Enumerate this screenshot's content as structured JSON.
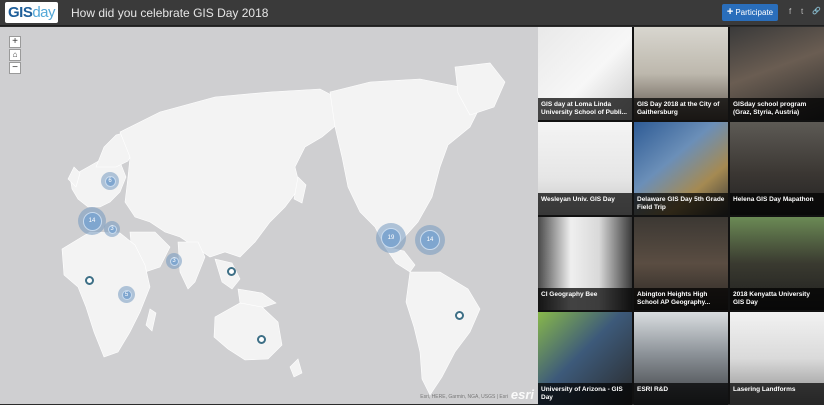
{
  "header": {
    "logo": {
      "gis": "GIS",
      "day": "day"
    },
    "title": "How did you celebrate GIS Day 2018",
    "participate_label": "Participate",
    "share_icons": [
      "facebook-icon",
      "twitter-icon",
      "link-icon"
    ],
    "share_glyphs": [
      "f",
      "t",
      "🔗"
    ]
  },
  "map": {
    "zoom_in": "+",
    "home_icon": "home-icon",
    "zoom_out": "−",
    "clusters": [
      {
        "count": "6"
      },
      {
        "count": "14"
      },
      {
        "count": "3"
      },
      {
        "count": "3"
      },
      {
        "count": "5"
      },
      {
        "count": "19"
      },
      {
        "count": "14"
      }
    ],
    "attribution": "Esri, HERE, Garmin, NGA, USGS | Esri",
    "esri_logo": "esri"
  },
  "gallery": {
    "items": [
      {
        "caption": "GIS day at Loma Linda University School of Publi..."
      },
      {
        "caption": "GIS Day 2018 at the City of Gaithersburg"
      },
      {
        "caption": "GISday school program (Graz, Styria, Austria)"
      },
      {
        "caption": "Wesleyan Univ. GIS Day"
      },
      {
        "caption": "Delaware GIS Day 5th Grade Field Trip"
      },
      {
        "caption": "Helena GIS Day Mapathon"
      },
      {
        "caption": "CI Geography Bee"
      },
      {
        "caption": "Abington Heights High School AP Geography..."
      },
      {
        "caption": "2018 Kenyatta University GIS Day"
      },
      {
        "caption": "University of Arizona - GIS Day"
      },
      {
        "caption": "ESRI R&D"
      },
      {
        "caption": "Lasering Landforms"
      }
    ]
  },
  "colors": {
    "accent": "#2a6ebb",
    "header_bg": "#3a3a3a",
    "map_bg": "#cfcfd1",
    "land": "#f2f2f2",
    "cluster": "#7fa6cf"
  }
}
